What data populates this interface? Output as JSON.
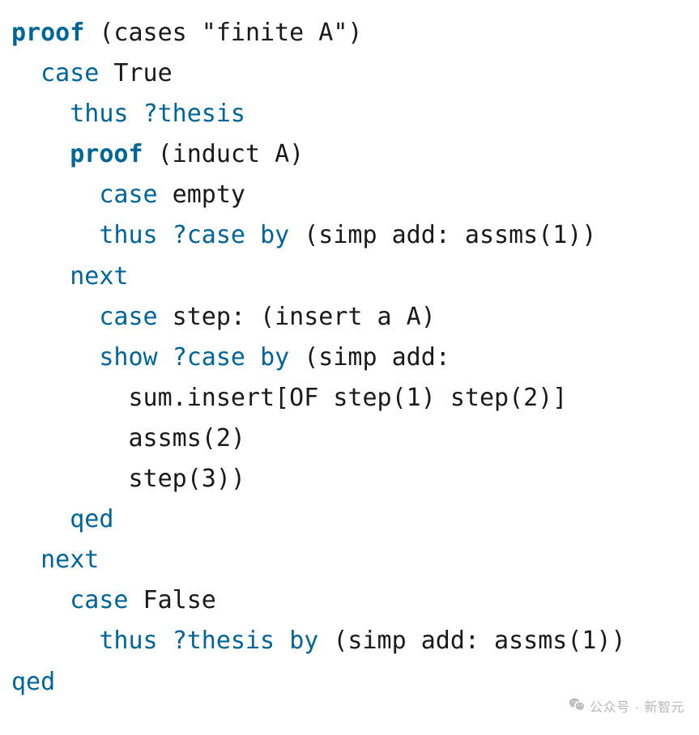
{
  "code": {
    "lines": [
      [
        {
          "cls": "kw-bold",
          "t": "proof"
        },
        {
          "cls": "txt",
          "t": " (cases \"finite A\")"
        }
      ],
      [
        {
          "cls": "txt",
          "t": "  "
        },
        {
          "cls": "kw",
          "t": "case"
        },
        {
          "cls": "txt",
          "t": " True"
        }
      ],
      [
        {
          "cls": "txt",
          "t": "    "
        },
        {
          "cls": "kw",
          "t": "thus"
        },
        {
          "cls": "txt",
          "t": " "
        },
        {
          "cls": "tvar",
          "t": "?thesis"
        }
      ],
      [
        {
          "cls": "txt",
          "t": "    "
        },
        {
          "cls": "kw-bold",
          "t": "proof"
        },
        {
          "cls": "txt",
          "t": " (induct A)"
        }
      ],
      [
        {
          "cls": "txt",
          "t": "      "
        },
        {
          "cls": "kw",
          "t": "case"
        },
        {
          "cls": "txt",
          "t": " empty"
        }
      ],
      [
        {
          "cls": "txt",
          "t": "      "
        },
        {
          "cls": "kw",
          "t": "thus"
        },
        {
          "cls": "txt",
          "t": " "
        },
        {
          "cls": "tvar",
          "t": "?case"
        },
        {
          "cls": "txt",
          "t": " "
        },
        {
          "cls": "kw",
          "t": "by"
        },
        {
          "cls": "txt",
          "t": " (simp add: assms(1))"
        }
      ],
      [
        {
          "cls": "txt",
          "t": "    "
        },
        {
          "cls": "kw",
          "t": "next"
        }
      ],
      [
        {
          "cls": "txt",
          "t": "      "
        },
        {
          "cls": "kw",
          "t": "case"
        },
        {
          "cls": "txt",
          "t": " step: (insert a A)"
        }
      ],
      [
        {
          "cls": "txt",
          "t": "      "
        },
        {
          "cls": "kw",
          "t": "show"
        },
        {
          "cls": "txt",
          "t": " "
        },
        {
          "cls": "tvar",
          "t": "?case"
        },
        {
          "cls": "txt",
          "t": " "
        },
        {
          "cls": "kw",
          "t": "by"
        },
        {
          "cls": "txt",
          "t": " (simp add:"
        }
      ],
      [
        {
          "cls": "txt",
          "t": "        sum.insert[OF step(1) step(2)]"
        }
      ],
      [
        {
          "cls": "txt",
          "t": "        assms(2)"
        }
      ],
      [
        {
          "cls": "txt",
          "t": "        step(3))"
        }
      ],
      [
        {
          "cls": "txt",
          "t": "    "
        },
        {
          "cls": "kw",
          "t": "qed"
        }
      ],
      [
        {
          "cls": "txt",
          "t": "  "
        },
        {
          "cls": "kw",
          "t": "next"
        }
      ],
      [
        {
          "cls": "txt",
          "t": "    "
        },
        {
          "cls": "kw",
          "t": "case"
        },
        {
          "cls": "txt",
          "t": " False"
        }
      ],
      [
        {
          "cls": "txt",
          "t": "      "
        },
        {
          "cls": "kw",
          "t": "thus"
        },
        {
          "cls": "txt",
          "t": " "
        },
        {
          "cls": "tvar",
          "t": "?thesis"
        },
        {
          "cls": "txt",
          "t": " "
        },
        {
          "cls": "kw",
          "t": "by"
        },
        {
          "cls": "txt",
          "t": " (simp add: assms(1))"
        }
      ],
      [
        {
          "cls": "kw",
          "t": "qed"
        }
      ]
    ]
  },
  "watermark": {
    "prefix": "公众号",
    "sep": "·",
    "name": "新智元"
  }
}
